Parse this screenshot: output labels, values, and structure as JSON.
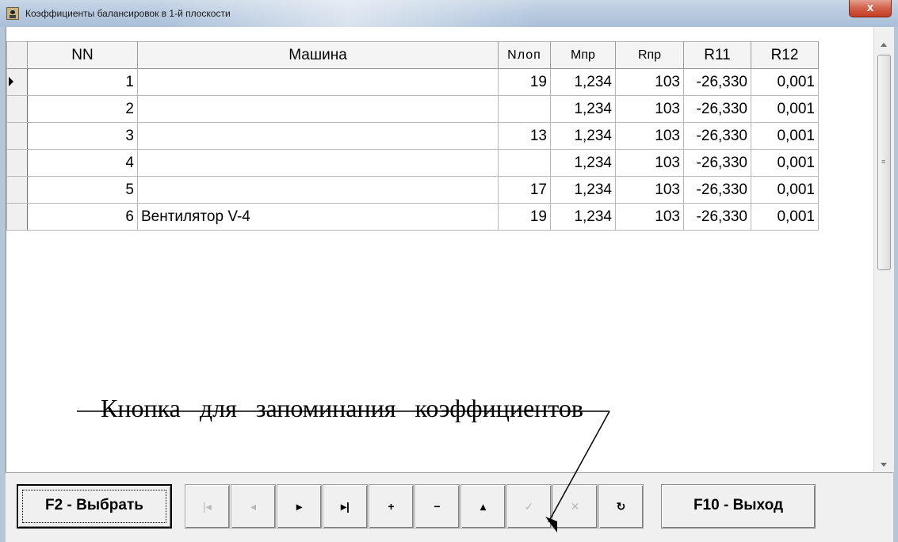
{
  "window": {
    "title": "Коэффициенты балансировок в 1-й плоскости",
    "close_glyph": "x"
  },
  "grid": {
    "columns": [
      "NN",
      "Машина",
      "Nлоп",
      "Мпр",
      "Rпр",
      "R11",
      "R12"
    ],
    "rows": [
      {
        "nn": "1",
        "machine": "",
        "nlop": "19",
        "mpr": "1,234",
        "rpr": "103",
        "r11": "-26,330",
        "r12": "0,001",
        "current": true
      },
      {
        "nn": "2",
        "machine": "",
        "nlop": "",
        "mpr": "1,234",
        "rpr": "103",
        "r11": "-26,330",
        "r12": "0,001",
        "current": false
      },
      {
        "nn": "3",
        "machine": "",
        "nlop": "13",
        "mpr": "1,234",
        "rpr": "103",
        "r11": "-26,330",
        "r12": "0,001",
        "current": false
      },
      {
        "nn": "4",
        "machine": "",
        "nlop": "",
        "mpr": "1,234",
        "rpr": "103",
        "r11": "-26,330",
        "r12": "0,001",
        "current": false
      },
      {
        "nn": "5",
        "machine": "",
        "nlop": "17",
        "mpr": "1,234",
        "rpr": "103",
        "r11": "-26,330",
        "r12": "0,001",
        "current": false
      },
      {
        "nn": "6",
        "machine": "Вентилятор V-4",
        "nlop": "19",
        "mpr": "1,234",
        "rpr": "103",
        "r11": "-26,330",
        "r12": "0,001",
        "current": false
      }
    ]
  },
  "annotation": {
    "text": "Кнопка для запоминания коэффициентов"
  },
  "toolbar": {
    "select_label": "F2 - Выбрать",
    "exit_label": "F10 - Выход",
    "navigator": [
      {
        "name": "nav-first-button",
        "glyph": "|◂",
        "enabled": false
      },
      {
        "name": "nav-prior-button",
        "glyph": "◂",
        "enabled": false
      },
      {
        "name": "nav-next-button",
        "glyph": "▸",
        "enabled": true
      },
      {
        "name": "nav-last-button",
        "glyph": "▸|",
        "enabled": true
      },
      {
        "name": "nav-insert-button",
        "glyph": "+",
        "enabled": true
      },
      {
        "name": "nav-delete-button",
        "glyph": "−",
        "enabled": true
      },
      {
        "name": "nav-edit-button",
        "glyph": "▴",
        "enabled": true
      },
      {
        "name": "nav-post-button",
        "glyph": "✓",
        "enabled": false
      },
      {
        "name": "nav-cancel-button",
        "glyph": "✕",
        "enabled": false
      },
      {
        "name": "nav-refresh-button",
        "glyph": "↻",
        "enabled": true
      }
    ]
  },
  "colors": {
    "titlebar": "#b9cbe0",
    "close_button": "#c9442a",
    "window_bg": "#f0f0f0"
  }
}
